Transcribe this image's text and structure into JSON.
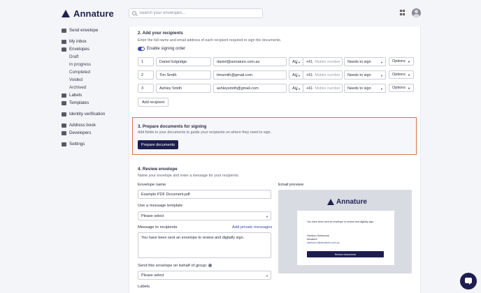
{
  "brand": {
    "name": "Annature"
  },
  "header": {
    "search_placeholder": "Search your envelopes..."
  },
  "sidebar": {
    "items": [
      {
        "label": "Send envelope",
        "sub": false
      },
      {
        "label": "My inbox",
        "sub": false
      },
      {
        "label": "Envelopes",
        "sub": false
      },
      {
        "label": "Draft",
        "sub": true
      },
      {
        "label": "In progress",
        "sub": true
      },
      {
        "label": "Completed",
        "sub": true
      },
      {
        "label": "Voided",
        "sub": true
      },
      {
        "label": "Archived",
        "sub": true
      },
      {
        "label": "Labels",
        "sub": false
      },
      {
        "label": "Templates",
        "sub": false
      },
      {
        "label": "Identity verification",
        "sub": false
      },
      {
        "label": "Address book",
        "sub": false
      },
      {
        "label": "Developers",
        "sub": false
      },
      {
        "label": "Settings",
        "sub": false
      }
    ]
  },
  "recipients_section": {
    "title": "2. Add your recipients",
    "subtitle": "Enter the full name and email address of each recipient required to sign the documents.",
    "toggle_label": "Enable signing order",
    "rows": [
      {
        "order": "1",
        "name": "Daniel Edgridge",
        "email": "daniel@annature.com.au",
        "country": "AU",
        "prefix": "+61",
        "mobile_placeholder": "Mobile number",
        "role": "Needs to sign",
        "options": "Options"
      },
      {
        "order": "2",
        "name": "Tim Smith",
        "email": "timsmith@gmail.com",
        "country": "AU",
        "prefix": "+61",
        "mobile_placeholder": "Mobile number",
        "role": "Needs to sign",
        "options": "Options"
      },
      {
        "order": "3",
        "name": "Ashley Smith",
        "email": "ashleysmith@gmail.com",
        "country": "AU",
        "prefix": "+61",
        "mobile_placeholder": "Mobile number",
        "role": "Needs to sign",
        "options": "Options"
      }
    ],
    "add_button": "Add recipient"
  },
  "prepare_section": {
    "title": "3. Prepare documents for signing",
    "subtitle": "Add fields to your documents to guide your recipients on where they need to sign.",
    "button": "Prepare documents"
  },
  "review_section": {
    "title": "4. Review envelope",
    "subtitle": "Name your envelope and enter a message for your recipients.",
    "envelope_name_label": "Envelope name",
    "envelope_name_value": "Example PDF Document.pdf",
    "template_label": "Use a message template",
    "template_value": "Please select",
    "message_label": "Message to recipients",
    "private_link": "Add private messages",
    "message_value": "You have been sent an envelope to review and digitally sign.",
    "group_label": "Send this envelope on behalf of group:",
    "group_value": "Please select",
    "labels_label": "Labels"
  },
  "email_preview": {
    "label": "Email preview",
    "brand": "Annature",
    "line1": "You have been sent an envelope to review and digitally sign.",
    "sender_name": "Harrison Hrebscouk",
    "sender_org": "Annature",
    "sender_email": "harrison.h@annature.com.au",
    "button": "Review documents"
  }
}
